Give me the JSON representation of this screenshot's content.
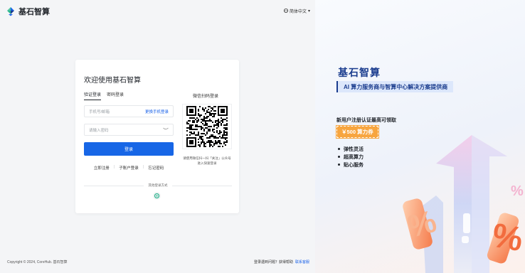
{
  "brand": {
    "name": "基石智算"
  },
  "language": {
    "label": "简体中文"
  },
  "login": {
    "welcome": "欢迎使用基石智算",
    "tabs": [
      "验证登录",
      "密码登录"
    ],
    "phone_placeholder": "手机号/邮箱",
    "switch_phone": "更换手机登录",
    "password_placeholder": "请输入密码",
    "login_button": "登录",
    "links": [
      "立即注册",
      "子账户登录",
      "忘记密码"
    ],
    "other_methods": "其他登录方式"
  },
  "qr": {
    "title": "微信扫码登录",
    "hint_line1": "请使用微信扫一扫「关注」公众号",
    "hint_line2": "进入快速登录"
  },
  "footer": {
    "copyright": "Copyright © 2024, CoreHub. 基石智算",
    "help_text": "登录遇到问题？获得帮助",
    "help_link": "联系客服"
  },
  "promo": {
    "title": "基石智算",
    "subtitle": "AI 算力服务商与智算中心解决方案提供商",
    "offer": "新用户注册认证最高可领取",
    "coupon": "￥500 算力券",
    "features": [
      "弹性灵活",
      "超高算力",
      "贴心服务"
    ]
  },
  "colors": {
    "primary": "#1766e6",
    "brand_navy": "#1a3c8e",
    "coupon": "#f7a53f"
  }
}
